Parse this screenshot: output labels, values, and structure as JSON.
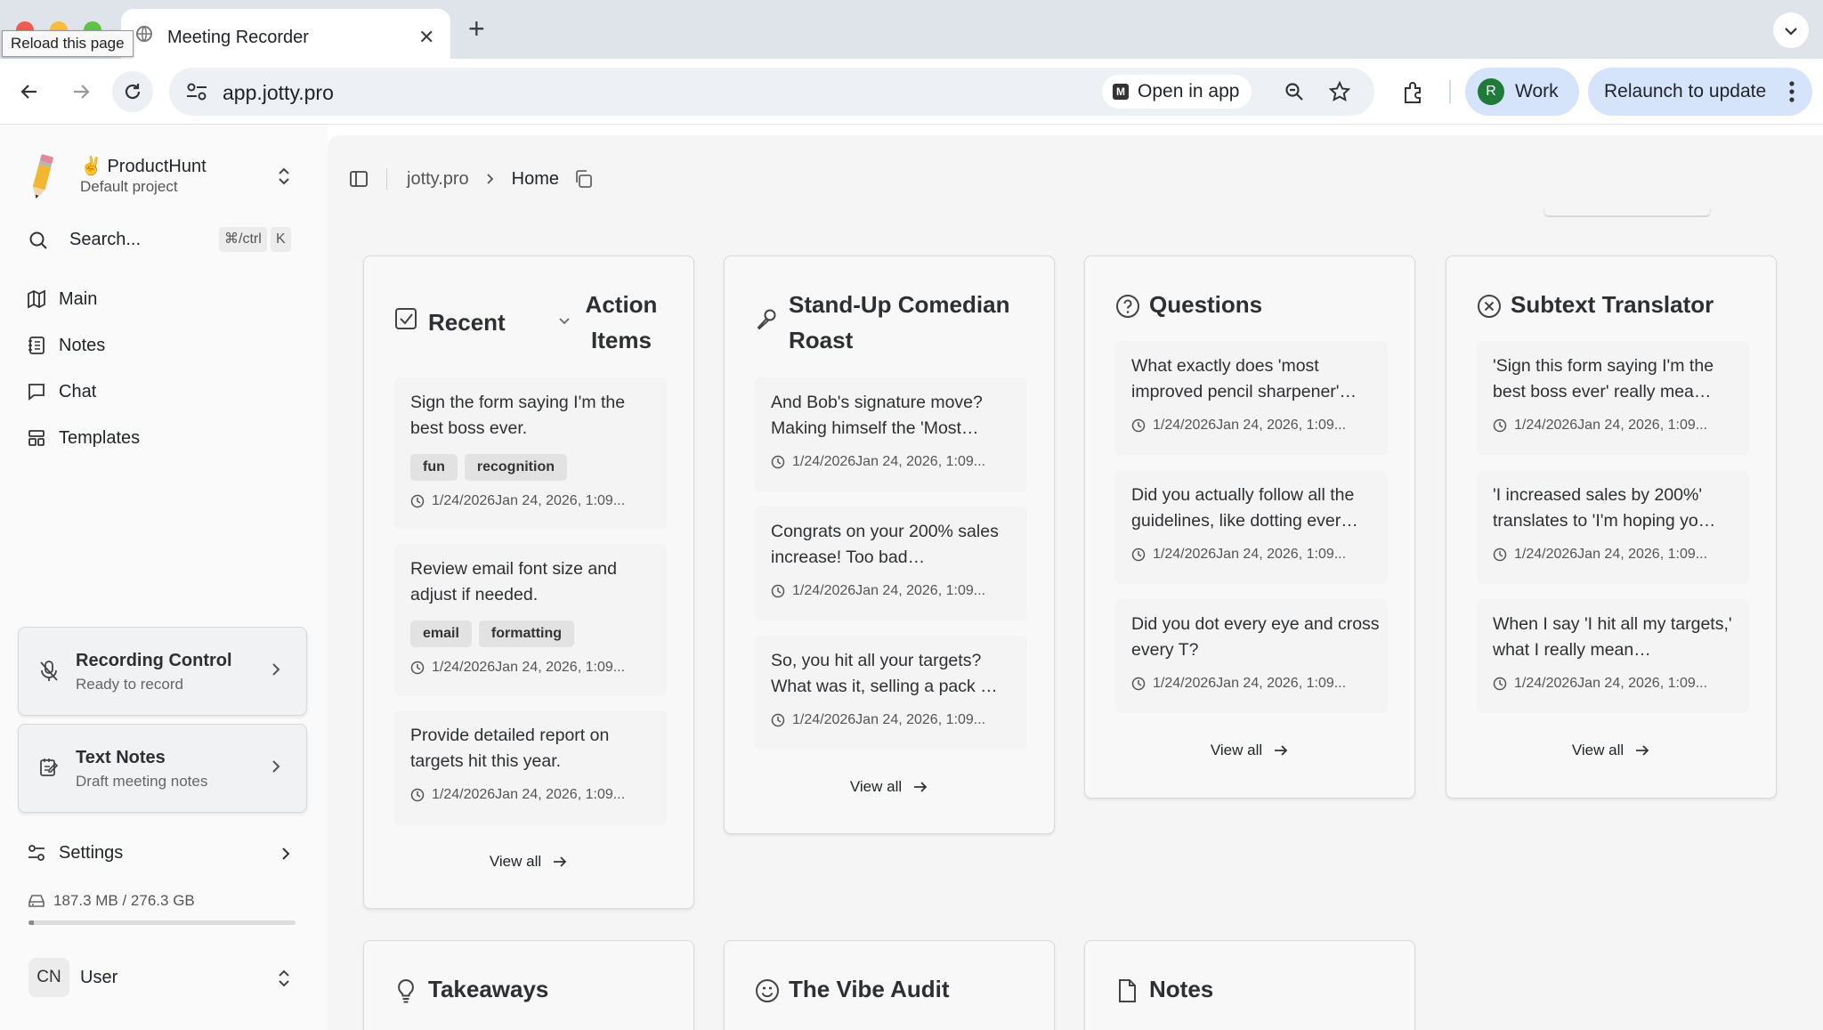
{
  "browser": {
    "tab_title": "Meeting Recorder",
    "tooltip": "Reload this page",
    "url": "app.jotty.pro",
    "open_in_app": "Open in app",
    "profile_initial": "R",
    "profile_name": "Work",
    "relaunch": "Relaunch to update"
  },
  "sidebar": {
    "project_name": "✌️ ProductHunt",
    "project_sub": "Default project",
    "search_label": "Search...",
    "search_shortcut_mod": "⌘/ctrl",
    "search_shortcut_key": "K",
    "nav": [
      {
        "label": "Main",
        "icon": "map-icon"
      },
      {
        "label": "Notes",
        "icon": "notebook-icon"
      },
      {
        "label": "Chat",
        "icon": "chat-icon"
      },
      {
        "label": "Templates",
        "icon": "templates-icon"
      }
    ],
    "recording": {
      "title": "Recording Control",
      "sub": "Ready to record"
    },
    "text_notes": {
      "title": "Text Notes",
      "sub": "Draft meeting notes"
    },
    "settings_label": "Settings",
    "storage": {
      "text": "187.3 MB / 276.3 GB",
      "used_fraction": 0.0007
    },
    "user": {
      "initials": "CN",
      "name": "User"
    }
  },
  "breadcrumb": {
    "root": "jotty.pro",
    "current": "Home"
  },
  "cards": {
    "recent": {
      "title": "Recent",
      "dropdown": "Action Items",
      "items": [
        {
          "text": "Sign the form saying I'm the best boss ever.",
          "tags": [
            "fun",
            "recognition"
          ],
          "time": "1/24/2026Jan 24, 2026, 1:09..."
        },
        {
          "text": "Review email font size and adjust if needed.",
          "tags": [
            "email",
            "formatting"
          ],
          "time": "1/24/2026Jan 24, 2026, 1:09..."
        },
        {
          "text": "Provide detailed report on targets hit this year.",
          "time": "1/24/2026Jan 24, 2026, 1:09..."
        }
      ],
      "view_all": "View all"
    },
    "roast": {
      "title": "Stand-Up Comedian Roast",
      "items": [
        {
          "text": "And Bob's signature move? Making himself the 'Most…",
          "time": "1/24/2026Jan 24, 2026, 1:09..."
        },
        {
          "text": "Congrats on your 200% sales increase! Too bad…",
          "time": "1/24/2026Jan 24, 2026, 1:09..."
        },
        {
          "text": "So, you hit all your targets? What was it, selling a pack …",
          "time": "1/24/2026Jan 24, 2026, 1:09..."
        }
      ],
      "view_all": "View all"
    },
    "questions": {
      "title": "Questions",
      "items": [
        {
          "text": "What exactly does 'most improved pencil sharpener'…",
          "time": "1/24/2026Jan 24, 2026, 1:09..."
        },
        {
          "text": "Did you actually follow all the guidelines, like dotting ever…",
          "time": "1/24/2026Jan 24, 2026, 1:09..."
        },
        {
          "text": "Did you dot every eye and cross every T?",
          "time": "1/24/2026Jan 24, 2026, 1:09..."
        }
      ],
      "view_all": "View all"
    },
    "subtext": {
      "title": "Subtext Translator",
      "items": [
        {
          "text": "'Sign this form saying I'm the best boss ever' really mea…",
          "time": "1/24/2026Jan 24, 2026, 1:09..."
        },
        {
          "text": "'I increased sales by 200%' translates to 'I'm hoping yo…",
          "time": "1/24/2026Jan 24, 2026, 1:09..."
        },
        {
          "text": "When I say 'I hit all my targets,' what I really mean…",
          "time": "1/24/2026Jan 24, 2026, 1:09..."
        }
      ],
      "view_all": "View all"
    },
    "takeaways": {
      "title": "Takeaways"
    },
    "vibe": {
      "title": "The Vibe Audit"
    },
    "notes": {
      "title": "Notes"
    }
  }
}
